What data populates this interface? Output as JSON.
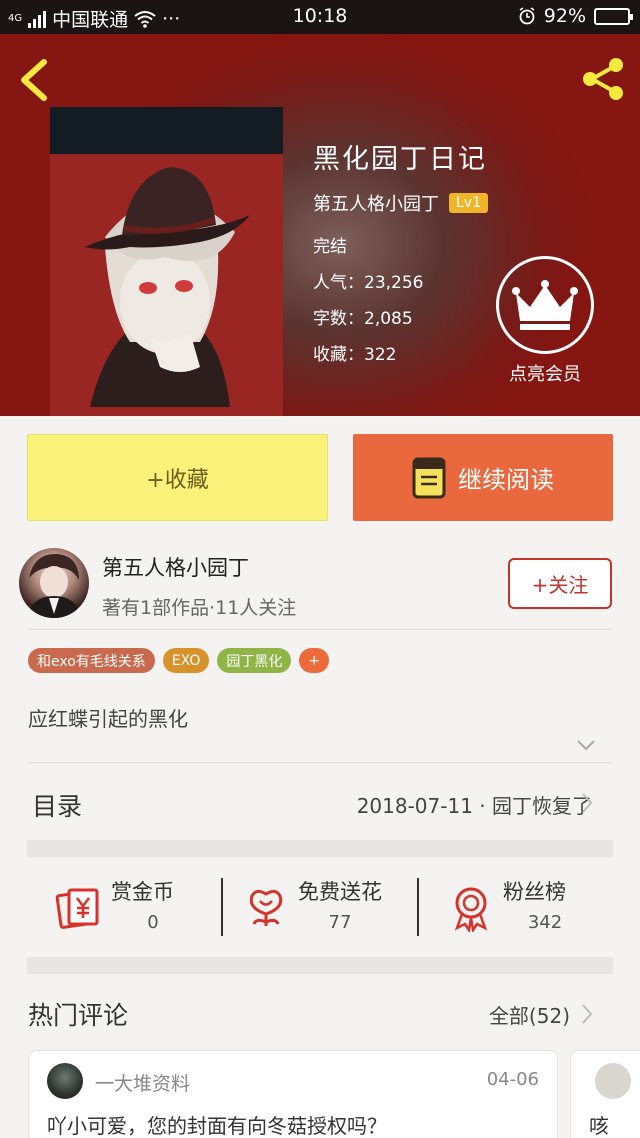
{
  "status_bar": {
    "network": "4G",
    "carrier": "中国联通",
    "more": "···",
    "time": "10:18",
    "battery": "92%",
    "battery_level": 0.92
  },
  "book": {
    "title": "黑化园丁日记",
    "author": "第五人格小园丁",
    "level": "Lv1",
    "status": "完结",
    "popularity": "人气：23,256",
    "word_count": "字数：2,085",
    "favorites": "收藏：322",
    "vip_label": "点亮会员"
  },
  "actions": {
    "favorite": "+收藏",
    "continue_reading": "继续阅读"
  },
  "author_card": {
    "name": "第五人格小园丁",
    "subtitle": "著有1部作品·11人关注",
    "follow": "+关注"
  },
  "tags": [
    {
      "label": "和exo有毛线关系",
      "color": "#c96a4e"
    },
    {
      "label": "EXO",
      "color": "#d8922c"
    },
    {
      "label": "园丁黑化",
      "color": "#8fb547"
    },
    {
      "label": "+",
      "color": "#ec6a3c"
    }
  ],
  "intro": "应红蝶引起的黑化",
  "toc": {
    "label": "目录",
    "latest": "2018-07-11 · 园丁恢复了"
  },
  "stats": [
    {
      "label": "赏金币",
      "value": "0",
      "icon": "red-envelope-icon"
    },
    {
      "label": "免费送花",
      "value": "77",
      "icon": "flower-icon"
    },
    {
      "label": "粉丝榜",
      "value": "342",
      "icon": "medal-icon"
    }
  ],
  "hot_comments": {
    "title": "热门评论",
    "all_label": "全部(52)",
    "items": [
      {
        "user": "一大堆资料",
        "date": "04-06",
        "text": "吖小可爱，您的封面有向冬菇授权吗？"
      },
      {
        "text": "咳"
      }
    ]
  },
  "colors": {
    "hero_red": "#861611",
    "read_button": "#e9683d",
    "favorite_button": "#fbf27a",
    "accent_red": "#c3352c"
  }
}
